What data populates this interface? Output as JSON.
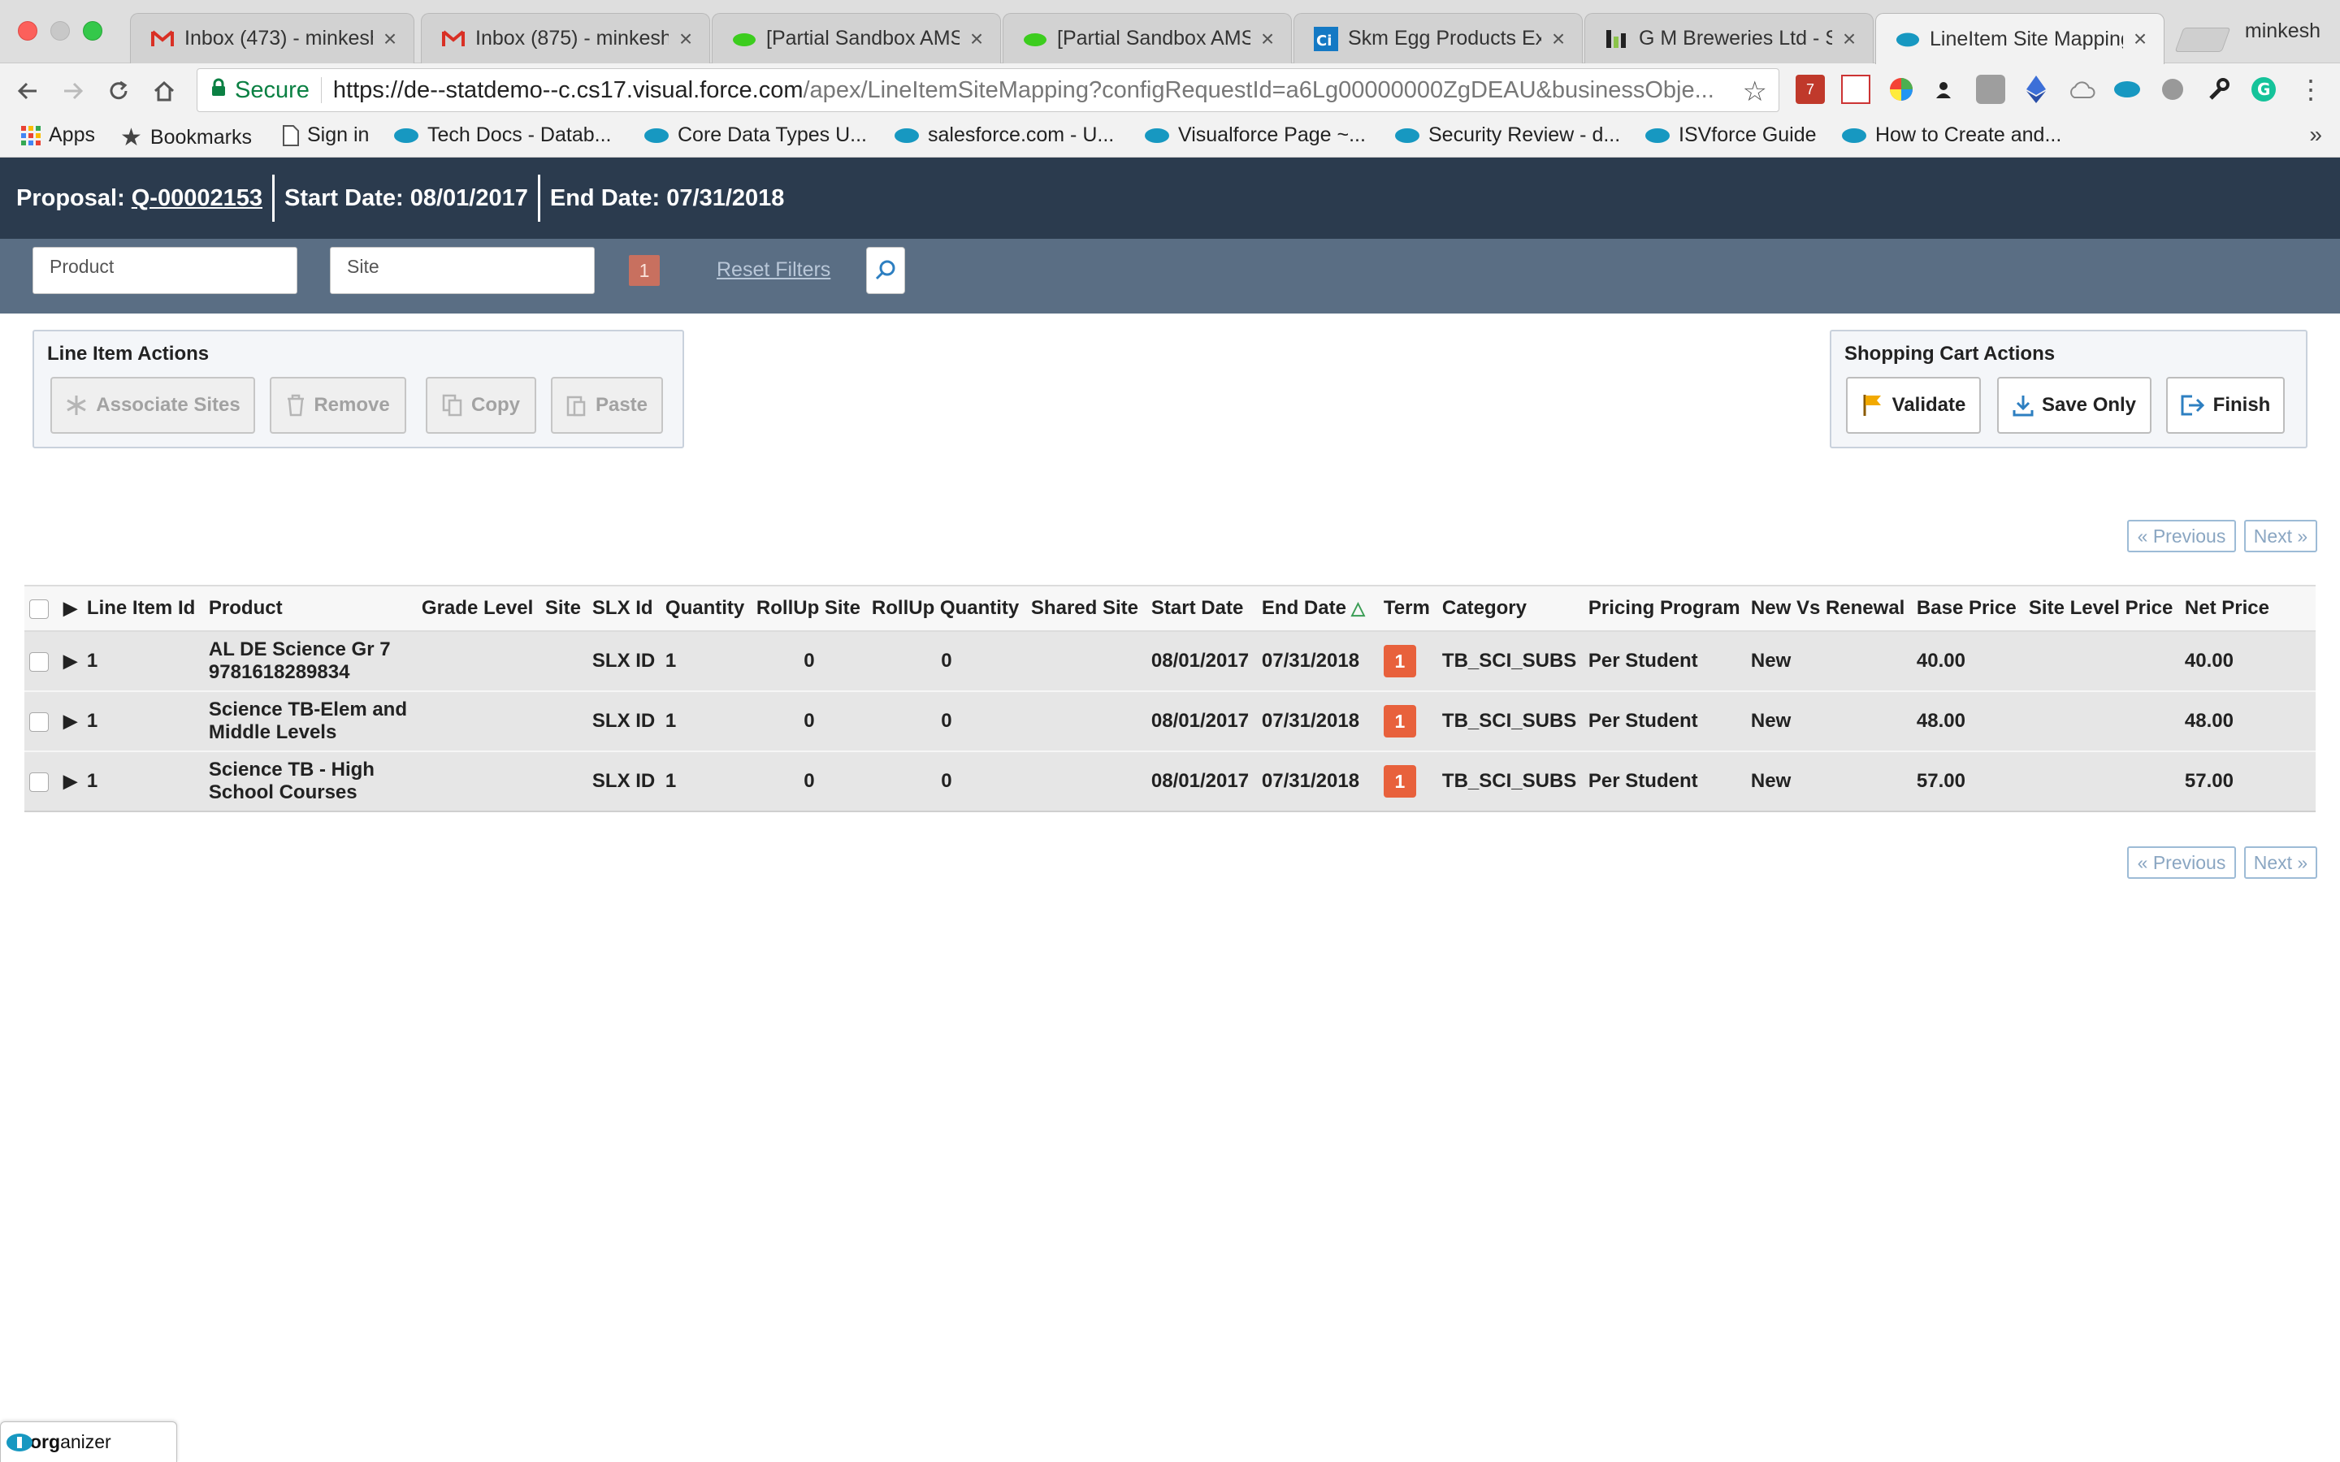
{
  "browser": {
    "tabs": [
      {
        "title": "Inbox (473) - minkesh",
        "icon": "gmail-icon"
      },
      {
        "title": "Inbox (875) - minkesh",
        "icon": "gmail-icon"
      },
      {
        "title": "[Partial Sandbox AMS",
        "icon": "cloud-icon"
      },
      {
        "title": "[Partial Sandbox AMS",
        "icon": "cloud-icon"
      },
      {
        "title": "Skm Egg Products Ex",
        "icon": "ci-icon"
      },
      {
        "title": "G M Breweries Ltd - S",
        "icon": "chart-icon"
      },
      {
        "title": "LineItem Site Mapping",
        "icon": "salesforce-icon",
        "active": true
      }
    ],
    "profile_name": "minkesh",
    "security_label": "Secure",
    "url_host": "https://de--statdemo--c.cs17.visual.force.com",
    "url_path": "/apex/LineItemSiteMapping?configRequestId=a6Lg00000000ZgDEAU&businessObje...",
    "extension_badge": "7",
    "bookmarks": [
      {
        "label": "Apps",
        "icon": "apps-grid-icon"
      },
      {
        "label": "Bookmarks",
        "icon": "star-icon"
      },
      {
        "label": "Sign in",
        "icon": "page-icon"
      },
      {
        "label": "Tech Docs - Datab...",
        "icon": "salesforce-icon"
      },
      {
        "label": "Core Data Types U...",
        "icon": "salesforce-icon"
      },
      {
        "label": "salesforce.com - U...",
        "icon": "salesforce-icon"
      },
      {
        "label": "Visualforce Page ~...",
        "icon": "salesforce-icon"
      },
      {
        "label": "Security Review - d...",
        "icon": "salesforce-icon"
      },
      {
        "label": "ISVforce Guide",
        "icon": "salesforce-icon"
      },
      {
        "label": "How to Create and...",
        "icon": "salesforce-icon"
      }
    ],
    "bookmarks_more": "»"
  },
  "header": {
    "proposal_label": "Proposal:",
    "proposal_id": "Q-00002153",
    "start_date_label": "Start Date:",
    "start_date": "08/01/2017",
    "end_date_label": "End Date:",
    "end_date": "07/31/2018"
  },
  "filters": {
    "product_placeholder": "Product",
    "site_placeholder": "Site",
    "filter_count": "1",
    "reset_label": "Reset Filters"
  },
  "line_item_actions": {
    "title": "Line Item Actions",
    "associate_sites": "Associate Sites",
    "remove": "Remove",
    "copy": "Copy",
    "paste": "Paste"
  },
  "cart_actions": {
    "title": "Shopping Cart Actions",
    "validate": "Validate",
    "save_only": "Save Only",
    "finish": "Finish"
  },
  "pagination": {
    "previous": "« Previous",
    "next": "Next »"
  },
  "table": {
    "columns": [
      "Line Item Id",
      "Product",
      "Grade Level",
      "Site",
      "SLX Id",
      "Quantity",
      "RollUp Site",
      "RollUp Quantity",
      "Shared Site",
      "Start Date",
      "End Date",
      "Term",
      "Category",
      "Pricing Program",
      "New Vs Renewal",
      "Base Price",
      "Site Level Price",
      "Net Price"
    ],
    "sort_indicator": "△",
    "rows": [
      {
        "line_item_id": "1",
        "product": "AL DE Science Gr 7 9781618289834",
        "grade_level": "",
        "site": "",
        "slx_id": "SLX ID",
        "quantity": "1",
        "rollup_site": "0",
        "rollup_quantity": "0",
        "shared_site": "",
        "start_date": "08/01/2017",
        "end_date": "07/31/2018",
        "term": "1",
        "category": "TB_SCI_SUBS",
        "pricing_program": "Per Student",
        "new_vs_renewal": "New",
        "base_price": "40.00",
        "site_level_price": "",
        "net_price": "40.00"
      },
      {
        "line_item_id": "1",
        "product": "Science TB-Elem and Middle Levels",
        "grade_level": "",
        "site": "",
        "slx_id": "SLX ID",
        "quantity": "1",
        "rollup_site": "0",
        "rollup_quantity": "0",
        "shared_site": "",
        "start_date": "08/01/2017",
        "end_date": "07/31/2018",
        "term": "1",
        "category": "TB_SCI_SUBS",
        "pricing_program": "Per Student",
        "new_vs_renewal": "New",
        "base_price": "48.00",
        "site_level_price": "",
        "net_price": "48.00"
      },
      {
        "line_item_id": "1",
        "product": "Science TB - High School Courses",
        "grade_level": "",
        "site": "",
        "slx_id": "SLX ID",
        "quantity": "1",
        "rollup_site": "0",
        "rollup_quantity": "0",
        "shared_site": "",
        "start_date": "08/01/2017",
        "end_date": "07/31/2018",
        "term": "1",
        "category": "TB_SCI_SUBS",
        "pricing_program": "Per Student",
        "new_vs_renewal": "New",
        "base_price": "57.00",
        "site_level_price": "",
        "net_price": "57.00"
      }
    ]
  },
  "organizer": {
    "prefix": "org",
    "suffix": "anizer"
  },
  "colors": {
    "header_bg": "#2b3b4e",
    "filterbar_bg": "#5a6e84",
    "term_badge": "#e8613c",
    "secure_green": "#0b8043"
  }
}
